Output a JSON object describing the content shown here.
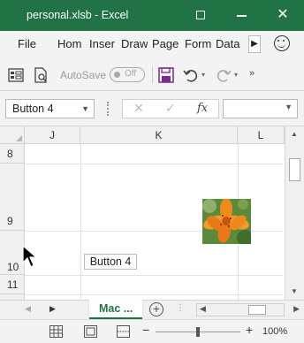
{
  "window": {
    "title": "personal.xlsb - Excel"
  },
  "ribbon": {
    "file": "File",
    "tabs": [
      "Hom",
      "Inser",
      "Draw",
      "Page",
      "Form",
      "Data"
    ]
  },
  "qat": {
    "autosave_label": "AutoSave",
    "autosave_state": "Off"
  },
  "formula_bar": {
    "name_box": "Button 4",
    "formula": ""
  },
  "grid": {
    "columns": [
      "J",
      "K",
      "L"
    ],
    "rows": [
      "8",
      "9",
      "10",
      "11"
    ],
    "button_label": "Button 4"
  },
  "sheets": {
    "active": "Mac ..."
  },
  "status": {
    "zoom": "100%"
  },
  "colors": {
    "excel_green": "#217346",
    "button_border": "#bbbbbb"
  }
}
